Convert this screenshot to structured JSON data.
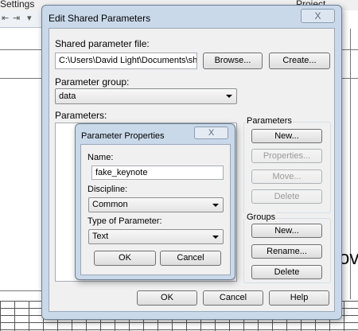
{
  "background": {
    "settings_label": "Settings",
    "project_location_label": "Project Location",
    "overflow_text": "ov"
  },
  "main_dialog": {
    "title": "Edit Shared Parameters",
    "close_glyph": "X",
    "shared_file_label": "Shared parameter file:",
    "shared_file_value": "C:\\Users\\David Light\\Documents\\shared_",
    "browse_label": "Browse...",
    "create_label": "Create...",
    "group_label": "Parameter group:",
    "group_value": "data",
    "parameters_label": "Parameters:",
    "parameters_box": {
      "title": "Parameters",
      "new_label": "New...",
      "properties_label": "Properties...",
      "move_label": "Move...",
      "delete_label": "Delete"
    },
    "groups_box": {
      "title": "Groups",
      "new_label": "New...",
      "rename_label": "Rename...",
      "delete_label": "Delete"
    },
    "ok_label": "OK",
    "cancel_label": "Cancel",
    "help_label": "Help"
  },
  "properties_dialog": {
    "title": "Parameter Properties",
    "close_glyph": "X",
    "name_label": "Name:",
    "name_value": "fake_keynote",
    "discipline_label": "Discipline:",
    "discipline_value": "Common",
    "type_label": "Type of Parameter:",
    "type_value": "Text",
    "ok_label": "OK",
    "cancel_label": "Cancel"
  }
}
